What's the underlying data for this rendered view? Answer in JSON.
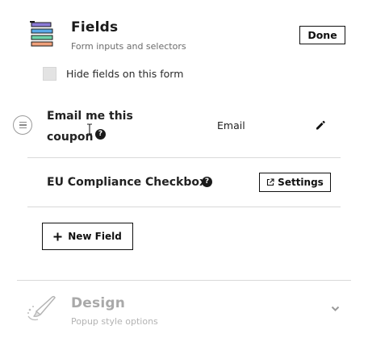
{
  "header": {
    "title": "Fields",
    "subtitle": "Form inputs and selectors",
    "done_label": "Done",
    "icon": "fields-stack-icon"
  },
  "hide_fields": {
    "label": "Hide fields on this form",
    "checked": false
  },
  "fields": [
    {
      "name": "Email me this coupon",
      "type": "Email",
      "has_help": true,
      "action_icon": "pencil-icon"
    },
    {
      "name": "EU Compliance Checkbox",
      "has_help": true,
      "action_label": "Settings",
      "action_icon": "external-link-icon"
    }
  ],
  "new_field_label": "New Field",
  "design": {
    "title": "Design",
    "subtitle": "Popup style options",
    "icon": "paintbrush-icon",
    "expand_icon": "chevron-down-icon"
  },
  "colors": {
    "icon_purple": "#8b7ad6",
    "icon_blue": "#5aa9e6",
    "icon_green": "#6fd3a8",
    "icon_orange": "#f0a07a",
    "text_dark": "#1a1a1a",
    "muted": "#a9a9a9"
  }
}
